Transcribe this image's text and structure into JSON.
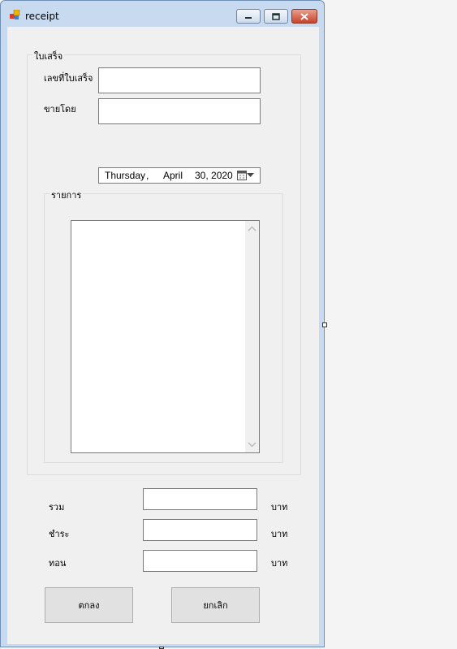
{
  "window": {
    "title": "receipt"
  },
  "receipt_group": {
    "title": "ใบเสร็จ",
    "receipt_no_label": "เลขที่ใบเสร็จ",
    "receipt_no_value": "",
    "sold_by_label": "ขายโดย",
    "sold_by_value": ""
  },
  "date": {
    "day": "Thursday",
    "sep": ",",
    "month": "April",
    "date_year": "30, 2020"
  },
  "items_group": {
    "title": "รายการ",
    "items": []
  },
  "totals": {
    "total_label": "รวม",
    "paid_label": "ชำระ",
    "change_label": "ทอน",
    "unit": "บาท",
    "total_value": "",
    "paid_value": "",
    "change_value": ""
  },
  "buttons": {
    "ok": "ตกลง",
    "cancel": "ยกเลิก"
  },
  "icons": {
    "app": "app-icon",
    "calendar": "calendar-icon",
    "dropdown": "chevron-down-icon"
  }
}
